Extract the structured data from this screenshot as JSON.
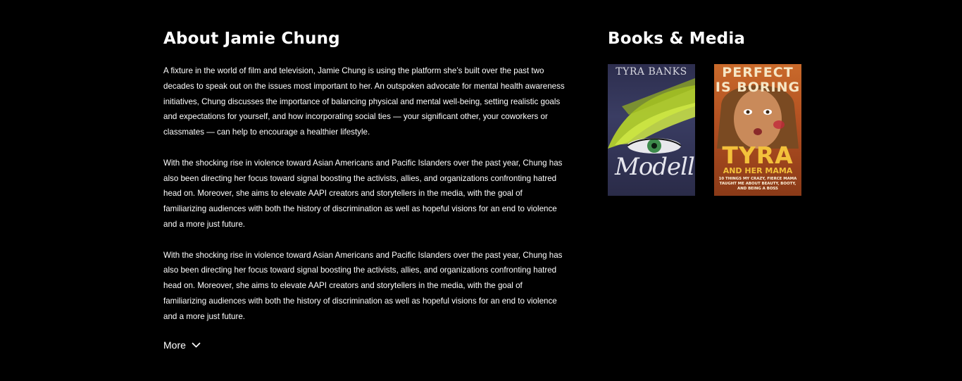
{
  "about": {
    "heading": "About Jamie Chung",
    "paragraphs": [
      "A fixture in the world of film and television, Jamie Chung is using the platform she’s built over the past two decades to speak out on the issues most important to her. An outspoken advocate for mental health awareness initiatives, Chung discusses the importance of balancing physical and mental well-being, setting realistic goals and expectations for yourself, and how incorporating social ties — your significant other, your coworkers or classmates — can help to encourage a healthier lifestyle.",
      "With the shocking rise in violence toward Asian Americans and Pacific Islanders over the past year, Chung has also been directing her focus toward signal boosting the activists, allies, and organizations confronting hatred head on. Moreover, she aims to elevate AAPI creators and storytellers in the media, with the goal of familiarizing audiences with both the history of discrimination as well as hopeful visions for an end to violence and a more just future.",
      "With the shocking rise in violence toward Asian Americans and Pacific Islanders over the past year, Chung has also been directing her focus toward signal boosting the activists, allies, and organizations confronting hatred head on. Moreover, she aims to elevate AAPI creators and storytellers in the media, with the goal of familiarizing audiences with both the history of discrimination as well as hopeful visions for an end to violence and a more just future."
    ],
    "more_label": "More",
    "more_icon": "chevron-down-icon"
  },
  "media": {
    "heading": "Books & Media",
    "books": [
      {
        "author": "TYRA BANKS",
        "title": "Modelland"
      },
      {
        "title": "PERFECT IS BORING",
        "author": "TYRA",
        "subtitle": "AND HER MAMA",
        "tagline": "10 THINGS MY CRAZY, FIERCE MAMA TAUGHT ME ABOUT BEAUTY, BOOTY, AND BEING A BOSS"
      }
    ]
  },
  "colors": {
    "background": "#000000",
    "text": "#ffffff",
    "book2_gold": "#f3c13b"
  }
}
